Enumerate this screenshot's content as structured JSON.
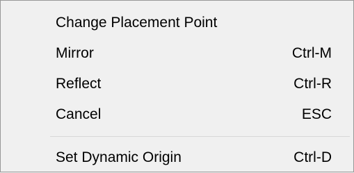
{
  "menu": {
    "items": [
      {
        "label": "Change Placement Point",
        "shortcut": ""
      },
      {
        "label": "Mirror",
        "shortcut": "Ctrl-M"
      },
      {
        "label": "Reflect",
        "shortcut": "Ctrl-R"
      },
      {
        "label": "Cancel",
        "shortcut": "ESC"
      },
      {
        "label": "Set Dynamic Origin",
        "shortcut": "Ctrl-D"
      }
    ]
  },
  "colors": {
    "background": "#f0f0f0",
    "border": "#979797",
    "separator": "#d7d7d7",
    "text": "#000000"
  }
}
